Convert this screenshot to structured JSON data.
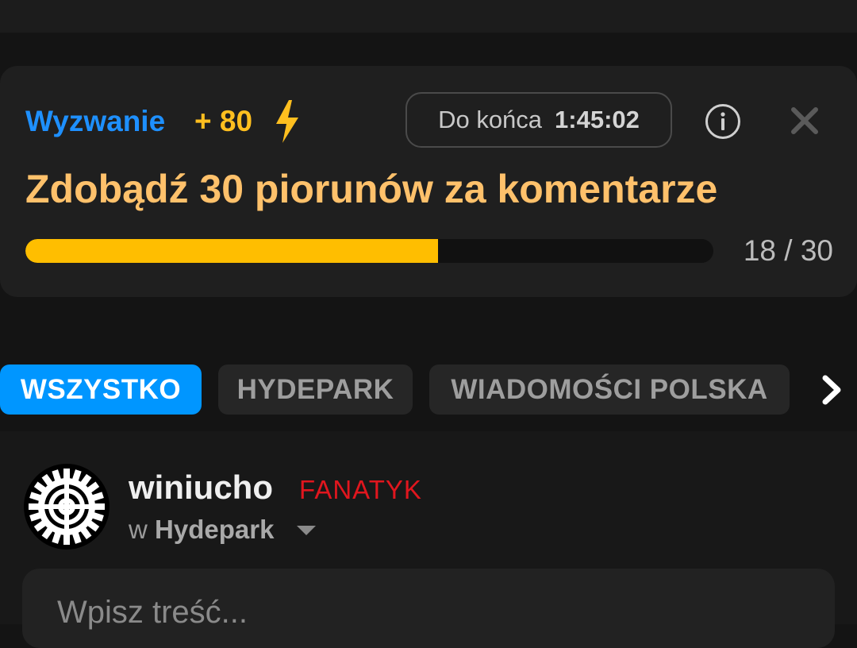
{
  "challenge": {
    "label": "Wyzwanie",
    "points": "+ 80",
    "timer_label": "Do końca",
    "timer_value": "1:45:02",
    "title": "Zdobądź 30 piorunów za komentarze",
    "progress_current": 18,
    "progress_total": 30,
    "progress_text": "18 / 30",
    "icons": {
      "reward": "lightning-bolt-icon",
      "info": "info-icon",
      "close": "close-icon"
    }
  },
  "tabs": [
    {
      "label": "WSZYSTKO",
      "active": true
    },
    {
      "label": "HYDEPARK",
      "active": false
    },
    {
      "label": "WIADOMOŚCI POLSKA",
      "active": false
    }
  ],
  "post": {
    "username": "winiucho",
    "rank": "FANATYK",
    "channel_prefix": "w",
    "channel": "Hydepark",
    "placeholder": "Wpisz treść..."
  },
  "colors": {
    "accent_blue": "#0096ff",
    "points_yellow": "#ffbf1f",
    "title_orange": "#ffc16b",
    "progress_fill": "#ffbe00",
    "rank_red": "#e0161e"
  }
}
